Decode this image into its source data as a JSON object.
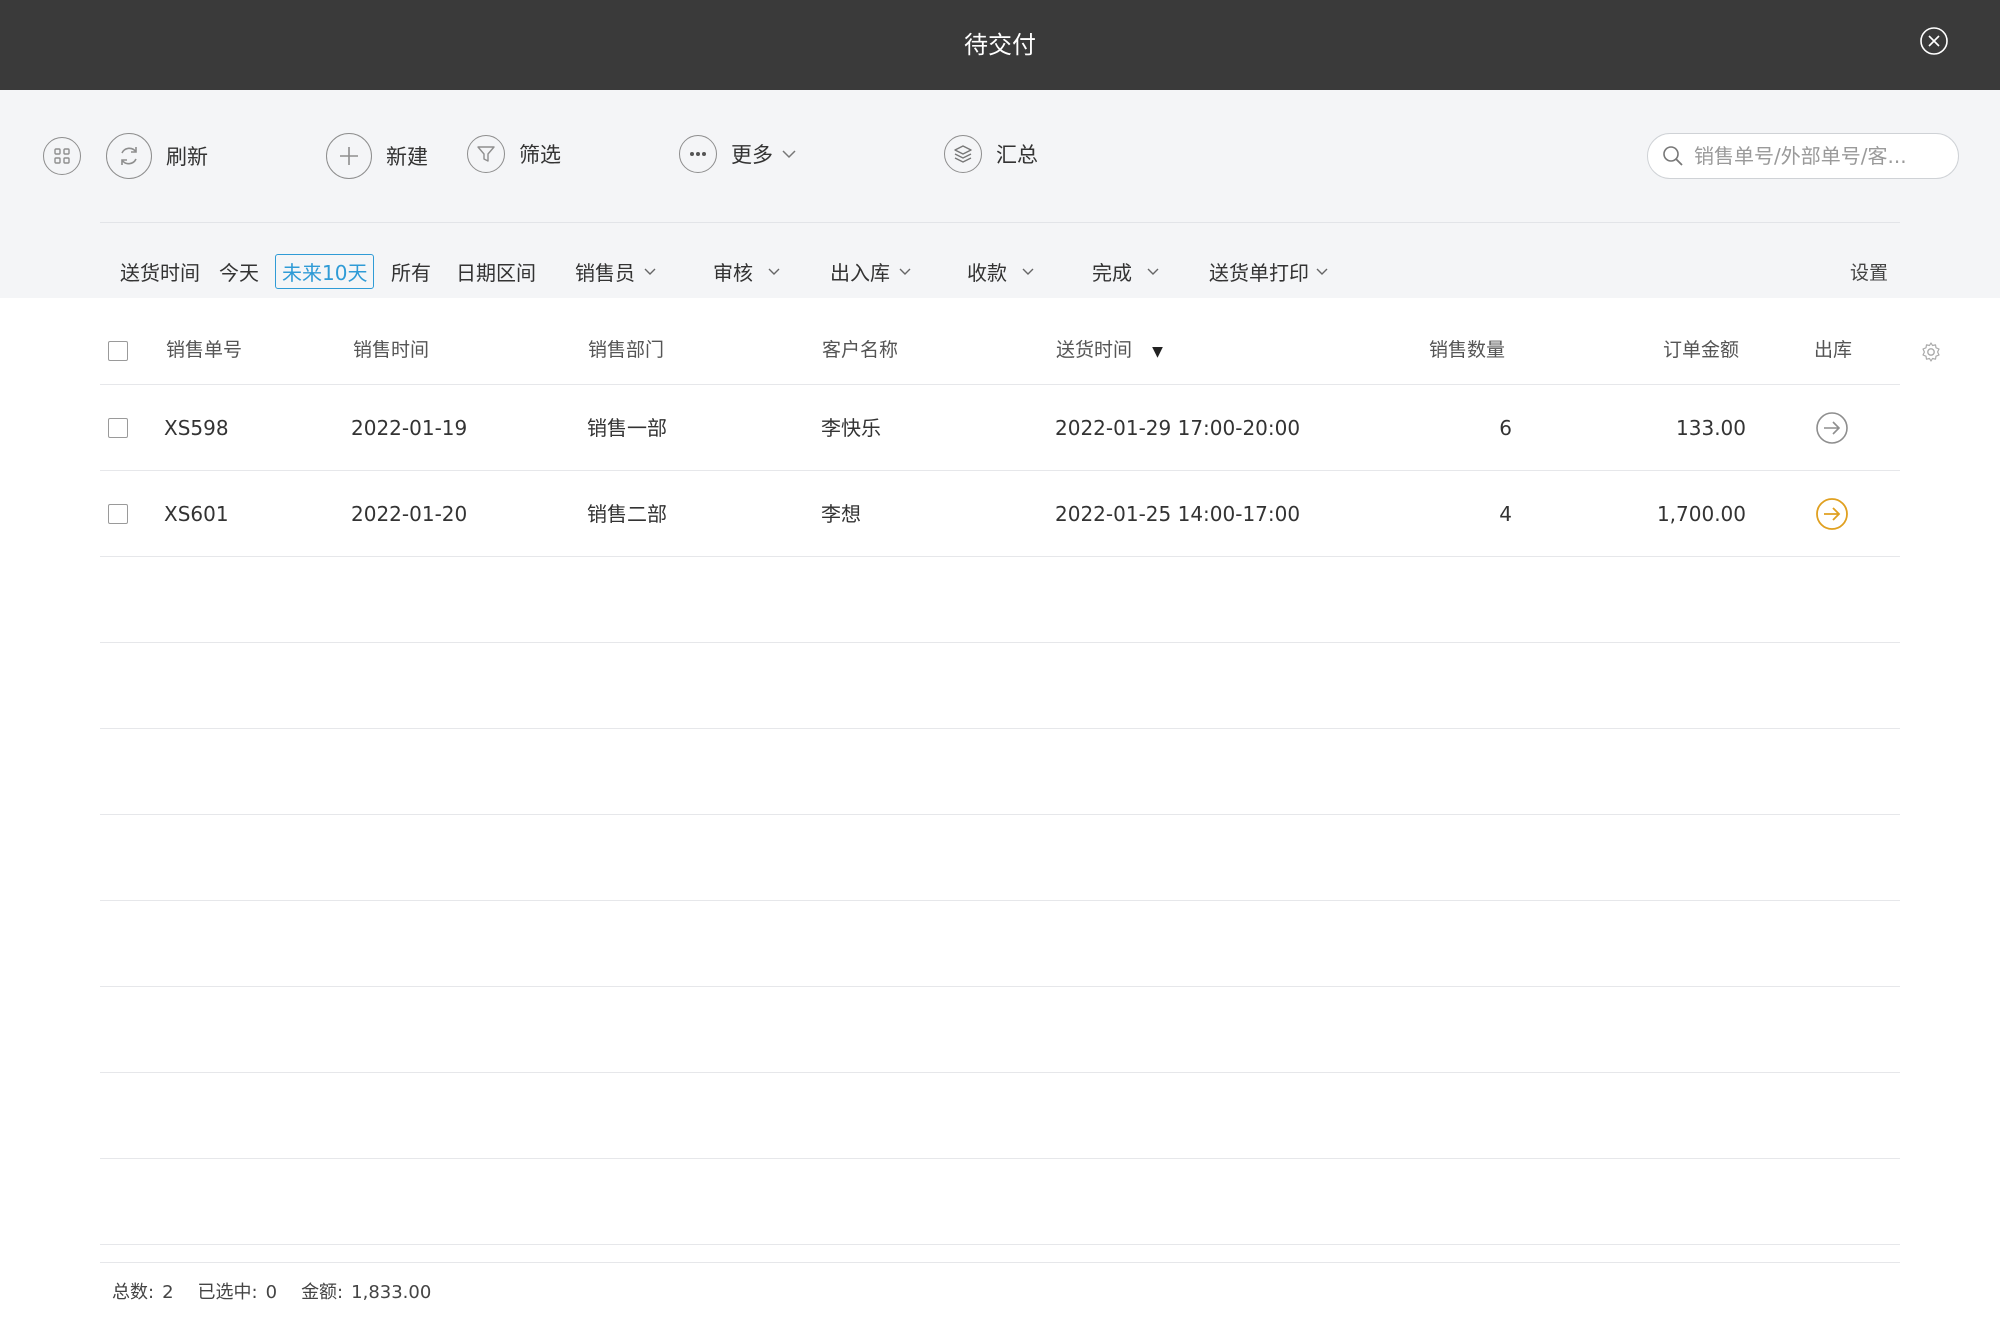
{
  "window": {
    "title": "待交付"
  },
  "toolbar": {
    "refresh": "刷新",
    "new": "新建",
    "filter": "筛选",
    "more": "更多",
    "summary": "汇总"
  },
  "search": {
    "placeholder": "销售单号/外部单号/客..."
  },
  "filters": {
    "delivery_time": "送货时间",
    "today": "今天",
    "next_10_days": "未来10天",
    "all": "所有",
    "date_range": "日期区间",
    "salesperson": "销售员",
    "audit": "审核",
    "stock": "出入库",
    "payment": "收款",
    "complete": "完成",
    "print": "送货单打印",
    "settings": "设置"
  },
  "table": {
    "headers": {
      "order_no": "销售单号",
      "sale_time": "销售时间",
      "dept": "销售部门",
      "customer": "客户名称",
      "delivery": "送货时间",
      "qty": "销售数量",
      "amount": "订单金额",
      "out": "出库"
    },
    "sort_indicator": "▼",
    "rows": [
      {
        "order_no": "XS598",
        "sale_time": "2022-01-19",
        "dept": "销售一部",
        "customer": "李快乐",
        "delivery": "2022-01-29  17:00-20:00",
        "qty": "6",
        "amount": "133.00",
        "out_color": "#8e8e8e"
      },
      {
        "order_no": "XS601",
        "sale_time": "2022-01-20",
        "dept": "销售二部",
        "customer": "李想",
        "delivery": "2022-01-25  14:00-17:00",
        "qty": "4",
        "amount": "1,700.00",
        "out_color": "#e0a020"
      }
    ]
  },
  "footer": {
    "total_label": "总数:",
    "total_value": "2",
    "selected_label": "已选中:",
    "selected_value": "0",
    "amount_label": "金额:",
    "amount_value": "1,833.00"
  }
}
